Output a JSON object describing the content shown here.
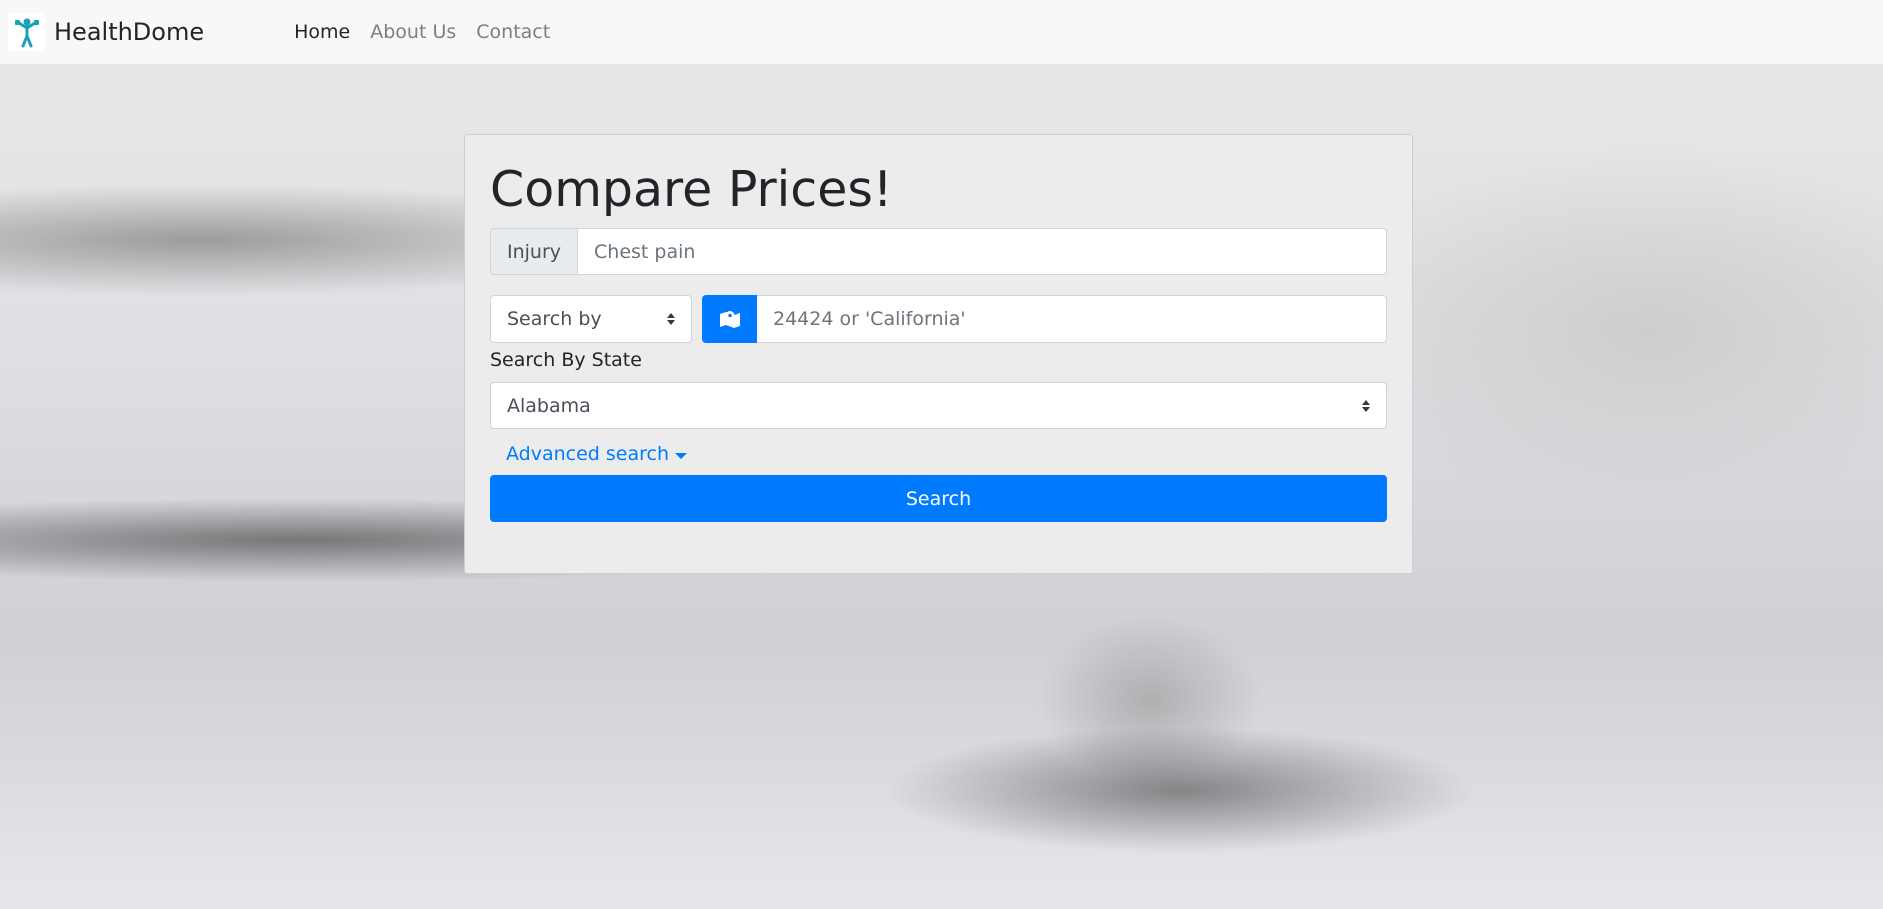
{
  "navbar": {
    "brand_name": "HealthDome",
    "links": [
      {
        "label": "Home",
        "active": true
      },
      {
        "label": "About Us",
        "active": false
      },
      {
        "label": "Contact",
        "active": false
      }
    ]
  },
  "form": {
    "title": "Compare Prices!",
    "injury_addon": "Injury",
    "injury_placeholder": "Chest pain",
    "search_by_label": "Search by",
    "map_icon": "map-marker-icon",
    "location_placeholder": "24424 or 'California'",
    "state_label": "Search By State",
    "state_selected": "Alabama",
    "advanced_search_label": "Advanced search",
    "search_button_label": "Search"
  },
  "colors": {
    "primary": "#007bff",
    "brand_icon": "#17a2b8"
  }
}
